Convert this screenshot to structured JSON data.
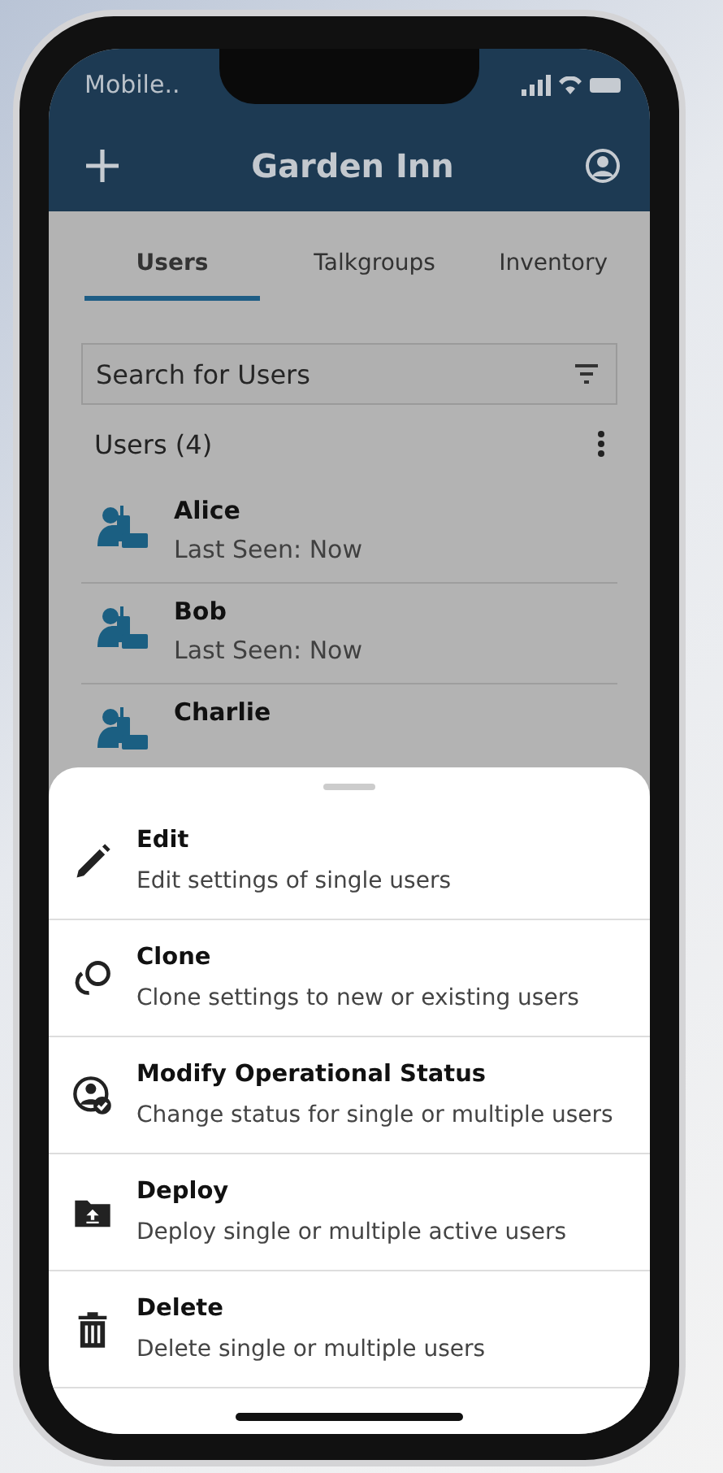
{
  "status_bar": {
    "carrier": "Mobile.."
  },
  "header": {
    "title": "Garden Inn"
  },
  "tabs": [
    {
      "label": "Users",
      "selected": true
    },
    {
      "label": "Talkgroups",
      "selected": false
    },
    {
      "label": "Inventory",
      "selected": false
    }
  ],
  "search": {
    "placeholder": "Search for Users"
  },
  "list_header": "Users (4)",
  "users": [
    {
      "name": "Alice",
      "status": "Last Seen: Now"
    },
    {
      "name": "Bob",
      "status": "Last Seen: Now"
    },
    {
      "name": "Charlie"
    }
  ],
  "action_sheet": [
    {
      "kind": "edit",
      "title": "Edit",
      "description": "Edit settings of single users"
    },
    {
      "kind": "clone",
      "title": "Clone",
      "description": "Clone settings to new or existing users"
    },
    {
      "kind": "status",
      "title": "Modify Operational Status",
      "description": "Change status for single or multiple users"
    },
    {
      "kind": "deploy",
      "title": "Deploy",
      "description": "Deploy single or multiple active users"
    },
    {
      "kind": "delete",
      "title": "Delete",
      "description": "Delete single or multiple users"
    }
  ]
}
